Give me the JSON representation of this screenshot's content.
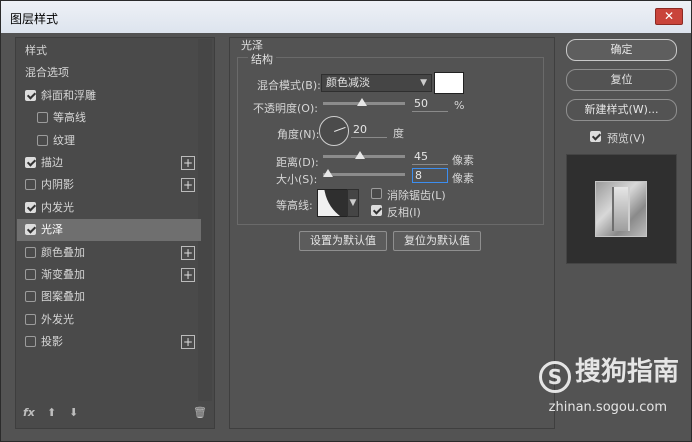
{
  "window": {
    "title": "图层样式",
    "close_icon": "✕"
  },
  "left": {
    "items": [
      {
        "label": "样式",
        "checkbox": null,
        "plus": false,
        "indent": 0
      },
      {
        "label": "混合选项",
        "checkbox": null,
        "plus": false,
        "indent": 0
      },
      {
        "label": "斜面和浮雕",
        "checkbox": true,
        "plus": false,
        "indent": 0
      },
      {
        "label": "等高线",
        "checkbox": false,
        "plus": false,
        "indent": 1
      },
      {
        "label": "纹理",
        "checkbox": false,
        "plus": false,
        "indent": 1
      },
      {
        "label": "描边",
        "checkbox": true,
        "plus": true,
        "indent": 0
      },
      {
        "label": "内阴影",
        "checkbox": false,
        "plus": true,
        "indent": 0
      },
      {
        "label": "内发光",
        "checkbox": true,
        "plus": false,
        "indent": 0
      },
      {
        "label": "光泽",
        "checkbox": true,
        "plus": false,
        "indent": 0,
        "selected": true
      },
      {
        "label": "颜色叠加",
        "checkbox": false,
        "plus": true,
        "indent": 0
      },
      {
        "label": "渐变叠加",
        "checkbox": false,
        "plus": true,
        "indent": 0
      },
      {
        "label": "图案叠加",
        "checkbox": false,
        "plus": false,
        "indent": 0
      },
      {
        "label": "外发光",
        "checkbox": false,
        "plus": false,
        "indent": 0
      },
      {
        "label": "投影",
        "checkbox": false,
        "plus": true,
        "indent": 0
      }
    ],
    "bottom": {
      "fx": "fx",
      "up": "⬆",
      "down": "⬇",
      "trash": "🗑"
    }
  },
  "center": {
    "section_title": "光泽",
    "group_title": "结构",
    "blend_mode_label": "混合模式(B):",
    "blend_mode_value": "颜色减淡",
    "opacity_label": "不透明度(O):",
    "opacity_value": "50",
    "opacity_unit": "%",
    "angle_label": "角度(N):",
    "angle_value": "20",
    "angle_unit": "度",
    "distance_label": "距离(D):",
    "distance_value": "45",
    "distance_unit": "像素",
    "size_label": "大小(S):",
    "size_value": "8",
    "size_unit": "像素",
    "contour_label": "等高线:",
    "antialias_label": "消除锯齿(L)",
    "antialias_checked": false,
    "invert_label": "反相(I)",
    "invert_checked": true,
    "set_default": "设置为默认值",
    "reset_default": "复位为默认值"
  },
  "right": {
    "ok": "确定",
    "reset": "复位",
    "new_style": "新建样式(W)...",
    "preview_label": "预览(V)",
    "preview_checked": true
  },
  "watermark": {
    "brand": "搜狗指南",
    "url": "zhinan.sogou.com",
    "logo_letter": "S"
  }
}
